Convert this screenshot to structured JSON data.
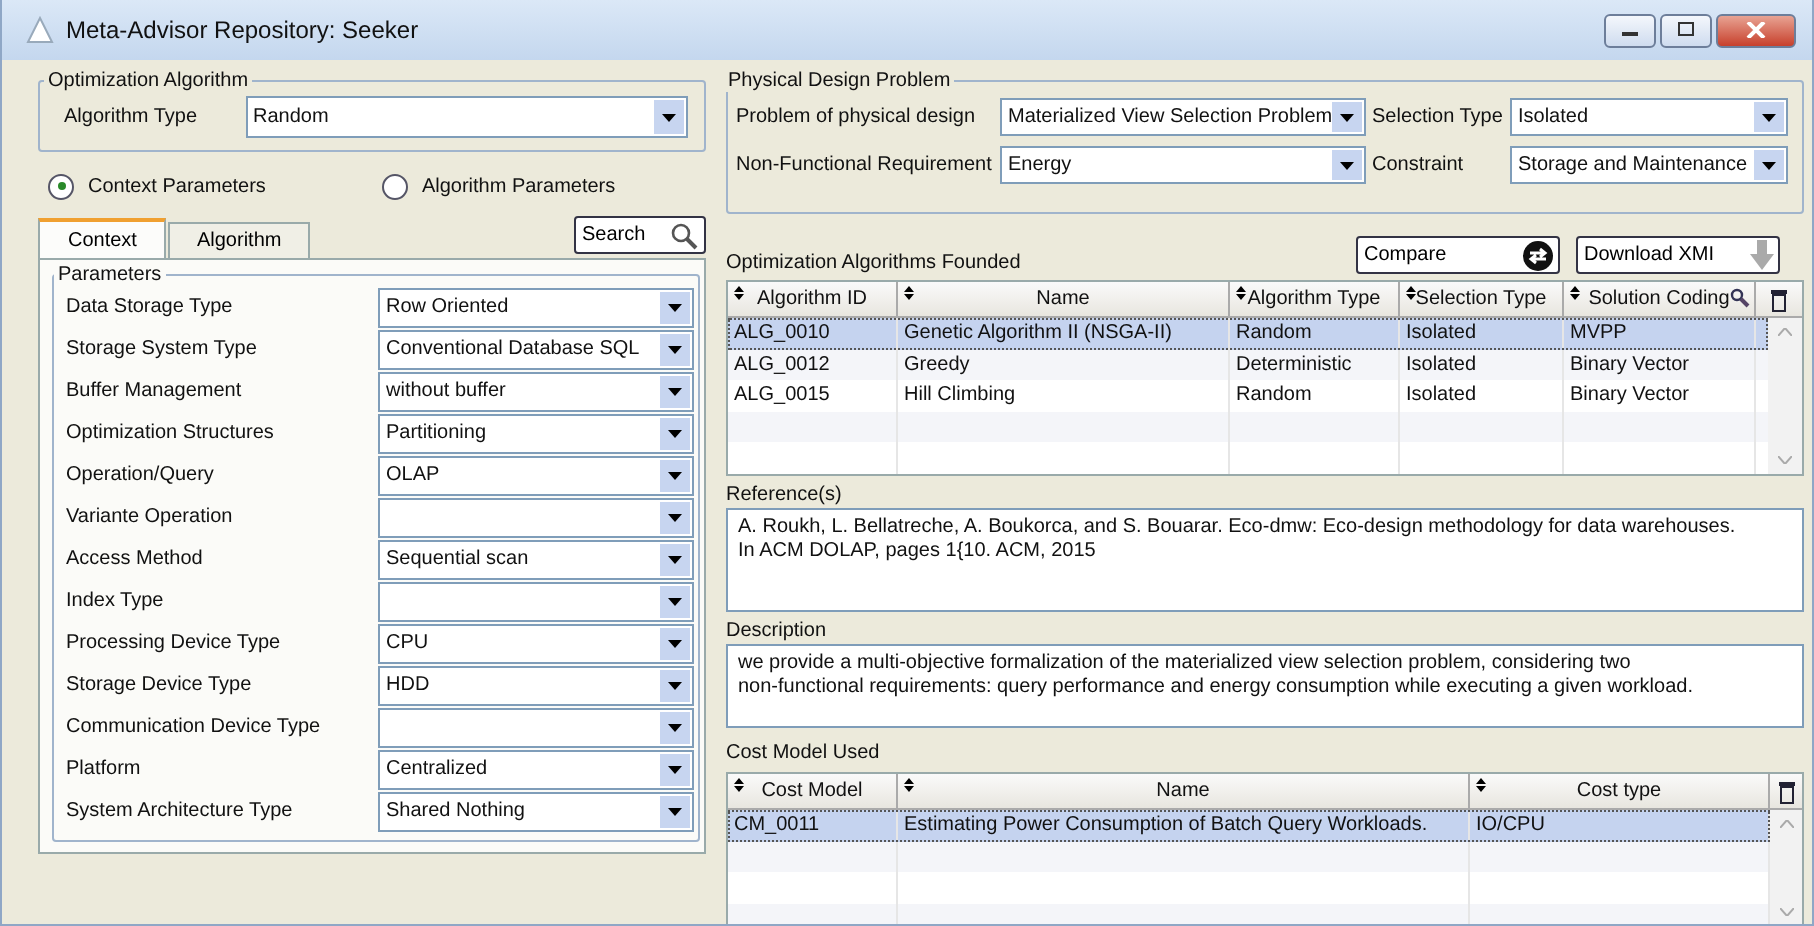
{
  "window": {
    "title": "Meta-Advisor Repository: Seeker"
  },
  "optimization_algorithm": {
    "legend": "Optimization Algorithm",
    "label": "Algorithm Type",
    "value": "Random"
  },
  "parameter_modes": [
    {
      "label": "Context Parameters",
      "selected": true
    },
    {
      "label": "Algorithm Parameters",
      "selected": false
    }
  ],
  "tabs": [
    {
      "label": "Context",
      "selected": true
    },
    {
      "label": "Algorithm",
      "selected": false
    }
  ],
  "search_button": {
    "label": "Search"
  },
  "parameters": {
    "legend": "Parameters",
    "items": [
      {
        "label": "Data Storage Type",
        "value": "Row Oriented"
      },
      {
        "label": "Storage System Type",
        "value": "Conventional Database SQL"
      },
      {
        "label": "Buffer Management",
        "value": "without buffer"
      },
      {
        "label": "Optimization Structures",
        "value": "Partitioning"
      },
      {
        "label": "Operation/Query",
        "value": "OLAP"
      },
      {
        "label": "Variante Operation",
        "value": ""
      },
      {
        "label": "Access Method",
        "value": "Sequential scan"
      },
      {
        "label": "Index Type",
        "value": ""
      },
      {
        "label": "Processing Device Type",
        "value": "CPU"
      },
      {
        "label": "Storage Device Type",
        "value": "HDD"
      },
      {
        "label": "Communication Device Type",
        "value": ""
      },
      {
        "label": "Platform",
        "value": "Centralized"
      },
      {
        "label": "System Architecture Type",
        "value": "Shared Nothing"
      }
    ]
  },
  "physical_design": {
    "legend": "Physical Design Problem",
    "fields": [
      {
        "label": "Problem of physical design",
        "value": "Materialized View Selection Problem"
      },
      {
        "label": "Selection Type",
        "value": "Isolated"
      },
      {
        "label": "Non-Functional Requirement",
        "value": "Energy"
      },
      {
        "label": "Constraint",
        "value": "Storage and Maintenance"
      }
    ]
  },
  "algorithms": {
    "title": "Optimization Algorithms Founded",
    "buttons": [
      {
        "label": "Compare",
        "kind": "compare"
      },
      {
        "label": "Download XMI",
        "kind": "download"
      }
    ],
    "columns": [
      "Algorithm ID",
      "Name",
      "Algorithm Type",
      "Selection Type",
      "Solution Coding"
    ],
    "rows": [
      {
        "cells": [
          "ALG_0010",
          "Genetic Algorithm II (NSGA-II)",
          "Random",
          "Isolated",
          "MVPP"
        ],
        "selected": true
      },
      {
        "cells": [
          "ALG_0012",
          "Greedy",
          "Deterministic",
          "Isolated",
          "Binary Vector"
        ],
        "selected": false
      },
      {
        "cells": [
          "ALG_0015",
          "Hill Climbing",
          "Random",
          "Isolated",
          "Binary Vector"
        ],
        "selected": false
      }
    ]
  },
  "references": {
    "label": "Reference(s)",
    "text": "A. Roukh, L. Bellatreche, A. Boukorca, and S. Bouarar. Eco-dmw: Eco-design methodology for data warehouses.\nIn ACM DOLAP, pages 1{10. ACM, 2015"
  },
  "description": {
    "label": "Description",
    "text": "we provide a multi-objective formalization of the materialized view selection problem, considering two\nnon-functional requirements:  query performance and energy consumption while executing a given workload."
  },
  "cost_models": {
    "title": "Cost Model Used",
    "columns": [
      "Cost Model",
      "Name",
      "Cost type"
    ],
    "rows": [
      {
        "cells": [
          "CM_0011",
          "Estimating Power Consumption of Batch Query Workloads.",
          "IO/CPU"
        ],
        "selected": true
      }
    ]
  }
}
